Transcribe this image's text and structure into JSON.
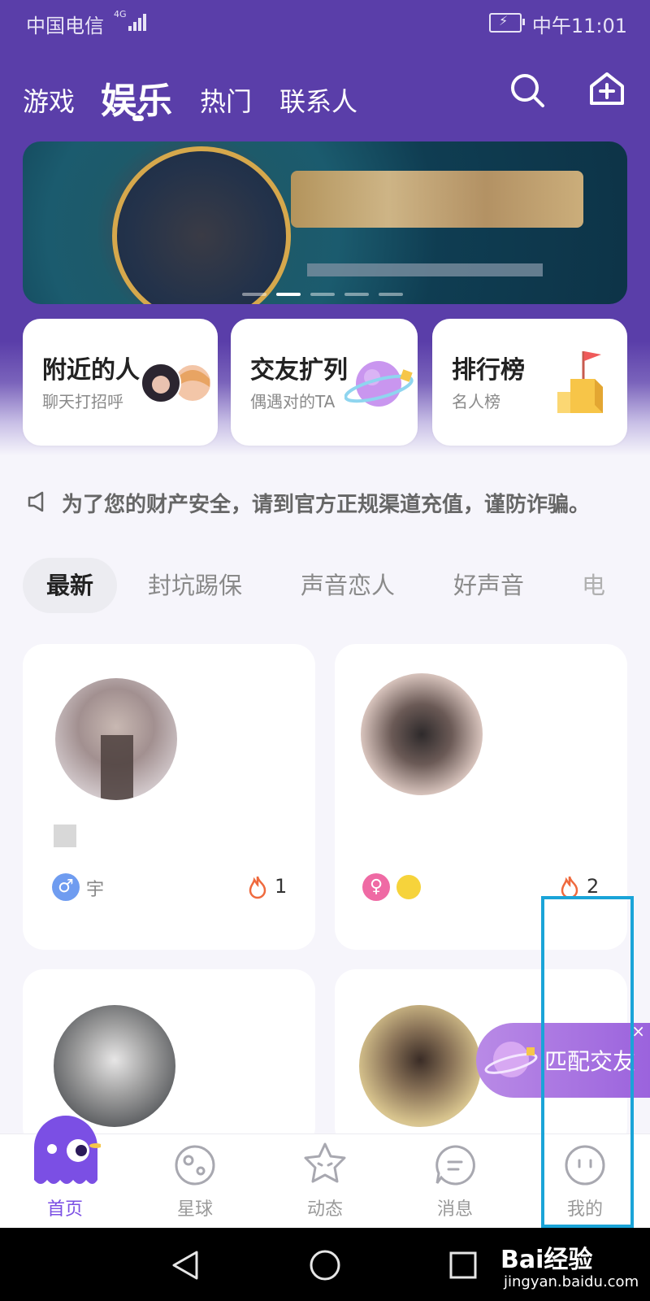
{
  "status_bar": {
    "carrier": "中国电信",
    "network": "4G",
    "time": "中午11:01"
  },
  "top_tabs": [
    {
      "label": "游戏",
      "active": false
    },
    {
      "label": "娱乐",
      "active": true
    },
    {
      "label": "热门",
      "active": false
    },
    {
      "label": "联系人",
      "active": false
    }
  ],
  "header_icons": [
    "search-icon",
    "home-plus-icon"
  ],
  "banner": {
    "slides": 5,
    "active_slide": 2
  },
  "features": [
    {
      "title": "附近的人",
      "subtitle": "聊天打招呼",
      "icon": "avatars-icon"
    },
    {
      "title": "交友扩列",
      "subtitle": "偶遇对的TA",
      "icon": "planet-icon"
    },
    {
      "title": "排行榜",
      "subtitle": "名人榜",
      "icon": "podium-flag-icon"
    }
  ],
  "notice": {
    "text": "为了您的财产安全，请到官方正规渠道充值，谨防诈骗。",
    "icon": "speaker-icon"
  },
  "categories": [
    {
      "label": "最新",
      "active": true
    },
    {
      "label": "封坑踢保",
      "active": false
    },
    {
      "label": "声音恋人",
      "active": false
    },
    {
      "label": "好声音",
      "active": false
    },
    {
      "label": "电台",
      "active": false
    }
  ],
  "rooms": [
    {
      "gender": "male",
      "tag": "宇",
      "hot": "1"
    },
    {
      "gender": "female",
      "tag": "",
      "hot": "2"
    },
    {
      "gender": "",
      "tag": "",
      "hot": ""
    },
    {
      "gender": "",
      "tag": "",
      "hot": ""
    }
  ],
  "floating": {
    "label": "匹配交友",
    "close": "×"
  },
  "bottom_nav": [
    {
      "label": "首页",
      "icon": "ghost-mascot-icon",
      "active": true
    },
    {
      "label": "星球",
      "icon": "planet-face-icon",
      "active": false
    },
    {
      "label": "动态",
      "icon": "star-face-icon",
      "active": false
    },
    {
      "label": "消息",
      "icon": "chat-bubble-icon",
      "active": false
    },
    {
      "label": "我的",
      "icon": "smiley-icon",
      "active": false
    }
  ],
  "watermark": {
    "brand": "Bai经验",
    "url": "jingyan.baidu.com"
  },
  "colors": {
    "header": "#5a3ea9",
    "accent": "#7d55e6",
    "highlight": "#1aa4d8"
  }
}
